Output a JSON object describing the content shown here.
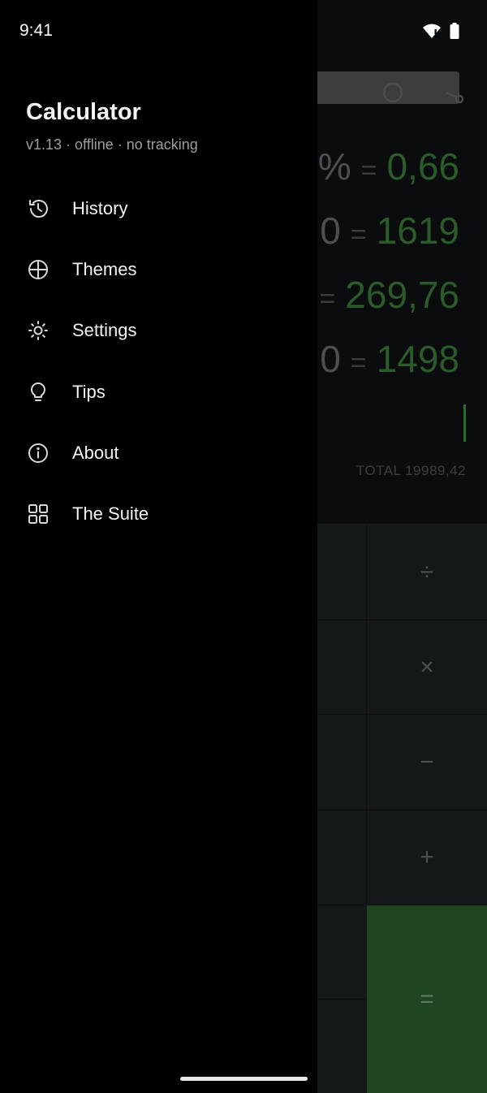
{
  "status_bar": {
    "time": "9:41"
  },
  "drawer": {
    "app_title": "Calculator",
    "app_subtitle": "v1.13 · offline · no tracking",
    "menu": [
      {
        "label": "History",
        "icon": "history-icon"
      },
      {
        "label": "Themes",
        "icon": "globe-icon"
      },
      {
        "label": "Settings",
        "icon": "sun-gear-icon"
      },
      {
        "label": "Tips",
        "icon": "lightbulb-icon"
      },
      {
        "label": "About",
        "icon": "info-icon"
      },
      {
        "label": "The Suite",
        "icon": "grid-icon"
      }
    ]
  },
  "calculator": {
    "history": [
      {
        "expr": ")%",
        "eq": "=",
        "result": "0,66"
      },
      {
        "expr": "0",
        "eq": "=",
        "result": "1619"
      },
      {
        "expr": "",
        "eq": "=",
        "result": "269,76"
      },
      {
        "expr": "0",
        "eq": "=",
        "result": "1498"
      }
    ],
    "total": "TOTAL 19989,42",
    "operators": [
      "÷",
      "×",
      "−",
      "+"
    ],
    "equals": "=",
    "colors": {
      "result_green": "#2b5a2b",
      "equals_key": "#1f4620",
      "drawer_bg": "#000000"
    }
  }
}
